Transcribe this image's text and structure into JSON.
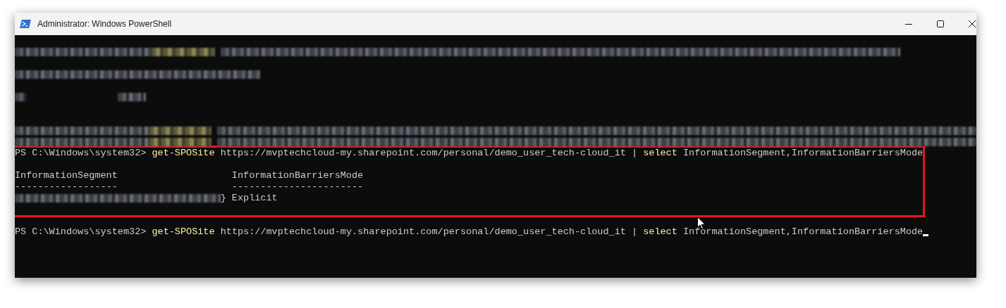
{
  "window": {
    "title": "Administrator: Windows PowerShell"
  },
  "blocks": [
    {
      "highlighted": false,
      "lines": [
        {
          "kind": "redacted"
        },
        {
          "kind": "blank"
        },
        {
          "kind": "redacted"
        },
        {
          "kind": "blank"
        },
        {
          "kind": "redacted"
        },
        {
          "kind": "blank"
        },
        {
          "kind": "blank"
        },
        {
          "kind": "redacted"
        },
        {
          "kind": "redacted"
        }
      ]
    },
    {
      "highlighted": true,
      "lines": [
        {
          "kind": "command",
          "prompt": "PS C:\\Windows\\system32>",
          "cmdlet": "get-SPOSite",
          "argument": "https://mvptechcloud-my.sharepoint.com/personal/demo_user_tech-cloud_it",
          "pipe": "|",
          "select": "select",
          "properties": "InformationSegment,InformationBarriersMode"
        },
        {
          "kind": "blank"
        },
        {
          "kind": "table_header",
          "cells": [
            {
              "text": "InformationSegment",
              "redacted": false
            },
            {
              "text": "InformationBarriersMode",
              "redacted": false
            }
          ]
        },
        {
          "kind": "table_rule",
          "cells": [
            {
              "text": "------------------",
              "redacted": false
            },
            {
              "text": "-----------------------",
              "redacted": false
            }
          ]
        },
        {
          "kind": "table_row",
          "cells": [
            {
              "text": "}",
              "redacted": true
            },
            {
              "text": "Explicit",
              "redacted": false
            }
          ]
        },
        {
          "kind": "blank"
        }
      ]
    },
    {
      "highlighted": false,
      "lines": [
        {
          "kind": "blank"
        },
        {
          "kind": "command",
          "cursor": true,
          "prompt": "PS C:\\Windows\\system32>",
          "cmdlet": "get-SPOSite",
          "argument": "https://mvptechcloud-my.sharepoint.com/personal/demo_user_tech-cloud_it",
          "pipe": "|",
          "select": "select",
          "properties": "InformationSegment,InformationBarriersMode"
        }
      ]
    }
  ]
}
